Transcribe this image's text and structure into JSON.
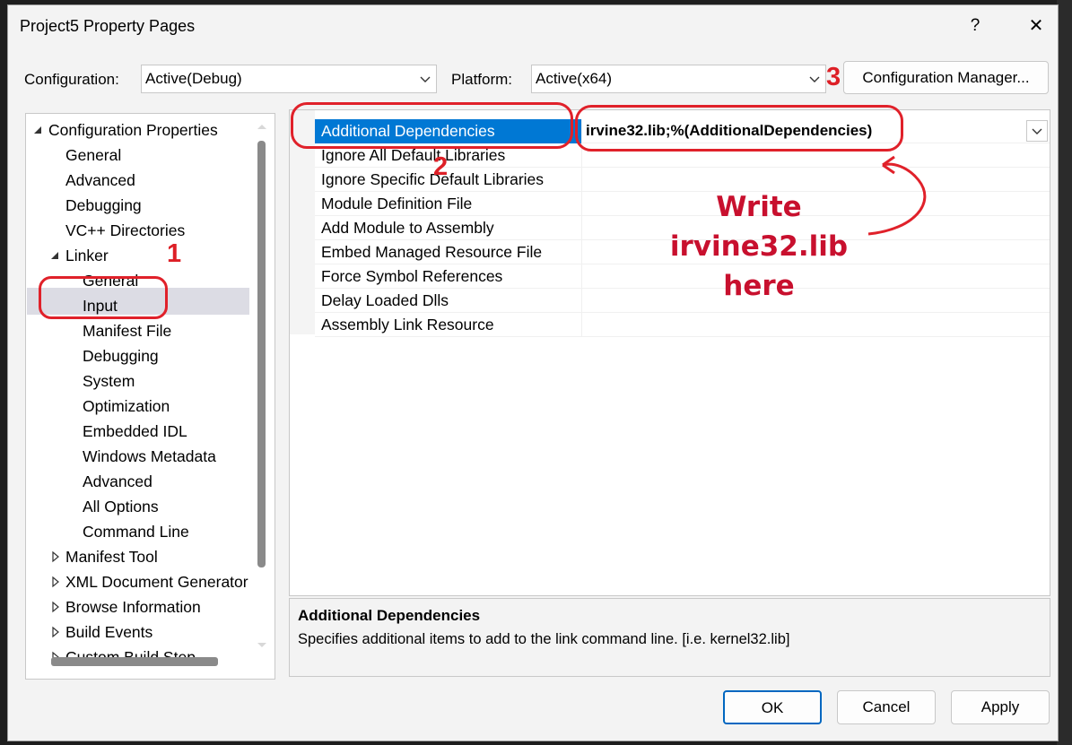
{
  "window": {
    "title": "Project5 Property Pages",
    "help_label": "?",
    "close_label": "✕"
  },
  "toolbar": {
    "configuration_label": "Configuration:",
    "configuration_value": "Active(Debug)",
    "platform_label": "Platform:",
    "platform_value": "Active(x64)",
    "config_manager_label": "Configuration Manager..."
  },
  "tree": {
    "items": [
      {
        "label": "Configuration Properties",
        "expander": "expanded"
      },
      {
        "label": "General"
      },
      {
        "label": "Advanced"
      },
      {
        "label": "Debugging"
      },
      {
        "label": "VC++ Directories"
      },
      {
        "label": "Linker",
        "expander": "expanded"
      },
      {
        "label": "General"
      },
      {
        "label": "Input",
        "selected": true
      },
      {
        "label": "Manifest File"
      },
      {
        "label": "Debugging"
      },
      {
        "label": "System"
      },
      {
        "label": "Optimization"
      },
      {
        "label": "Embedded IDL"
      },
      {
        "label": "Windows Metadata"
      },
      {
        "label": "Advanced"
      },
      {
        "label": "All Options"
      },
      {
        "label": "Command Line"
      },
      {
        "label": "Manifest Tool",
        "expander": "collapsed"
      },
      {
        "label": "XML Document Generator",
        "expander": "collapsed"
      },
      {
        "label": "Browse Information",
        "expander": "collapsed"
      },
      {
        "label": "Build Events",
        "expander": "collapsed"
      },
      {
        "label": "Custom Build Step",
        "expander": "collapsed"
      }
    ]
  },
  "grid": {
    "rows": [
      {
        "name": "Additional Dependencies",
        "value": "irvine32.lib;%(AdditionalDependencies)",
        "selected": true
      },
      {
        "name": "Ignore All Default Libraries",
        "value": ""
      },
      {
        "name": "Ignore Specific Default Libraries",
        "value": ""
      },
      {
        "name": "Module Definition File",
        "value": ""
      },
      {
        "name": "Add Module to Assembly",
        "value": ""
      },
      {
        "name": "Embed Managed Resource File",
        "value": ""
      },
      {
        "name": "Force Symbol References",
        "value": ""
      },
      {
        "name": "Delay Loaded Dlls",
        "value": ""
      },
      {
        "name": "Assembly Link Resource",
        "value": ""
      }
    ]
  },
  "description": {
    "title": "Additional Dependencies",
    "text": "Specifies additional items to add to the link command line. [i.e. kernel32.lib]"
  },
  "buttons": {
    "ok": "OK",
    "cancel": "Cancel",
    "apply": "Apply"
  },
  "annotations": {
    "step1": "1",
    "step2": "2",
    "step3": "3",
    "note_line1": "Write irvine32.lib",
    "note_line2": "here",
    "color": "#dd1f26"
  },
  "colors": {
    "selection_blue": "#0078d4",
    "tree_selection": "#dcdce4",
    "dialog_bg": "#f3f3f3"
  }
}
